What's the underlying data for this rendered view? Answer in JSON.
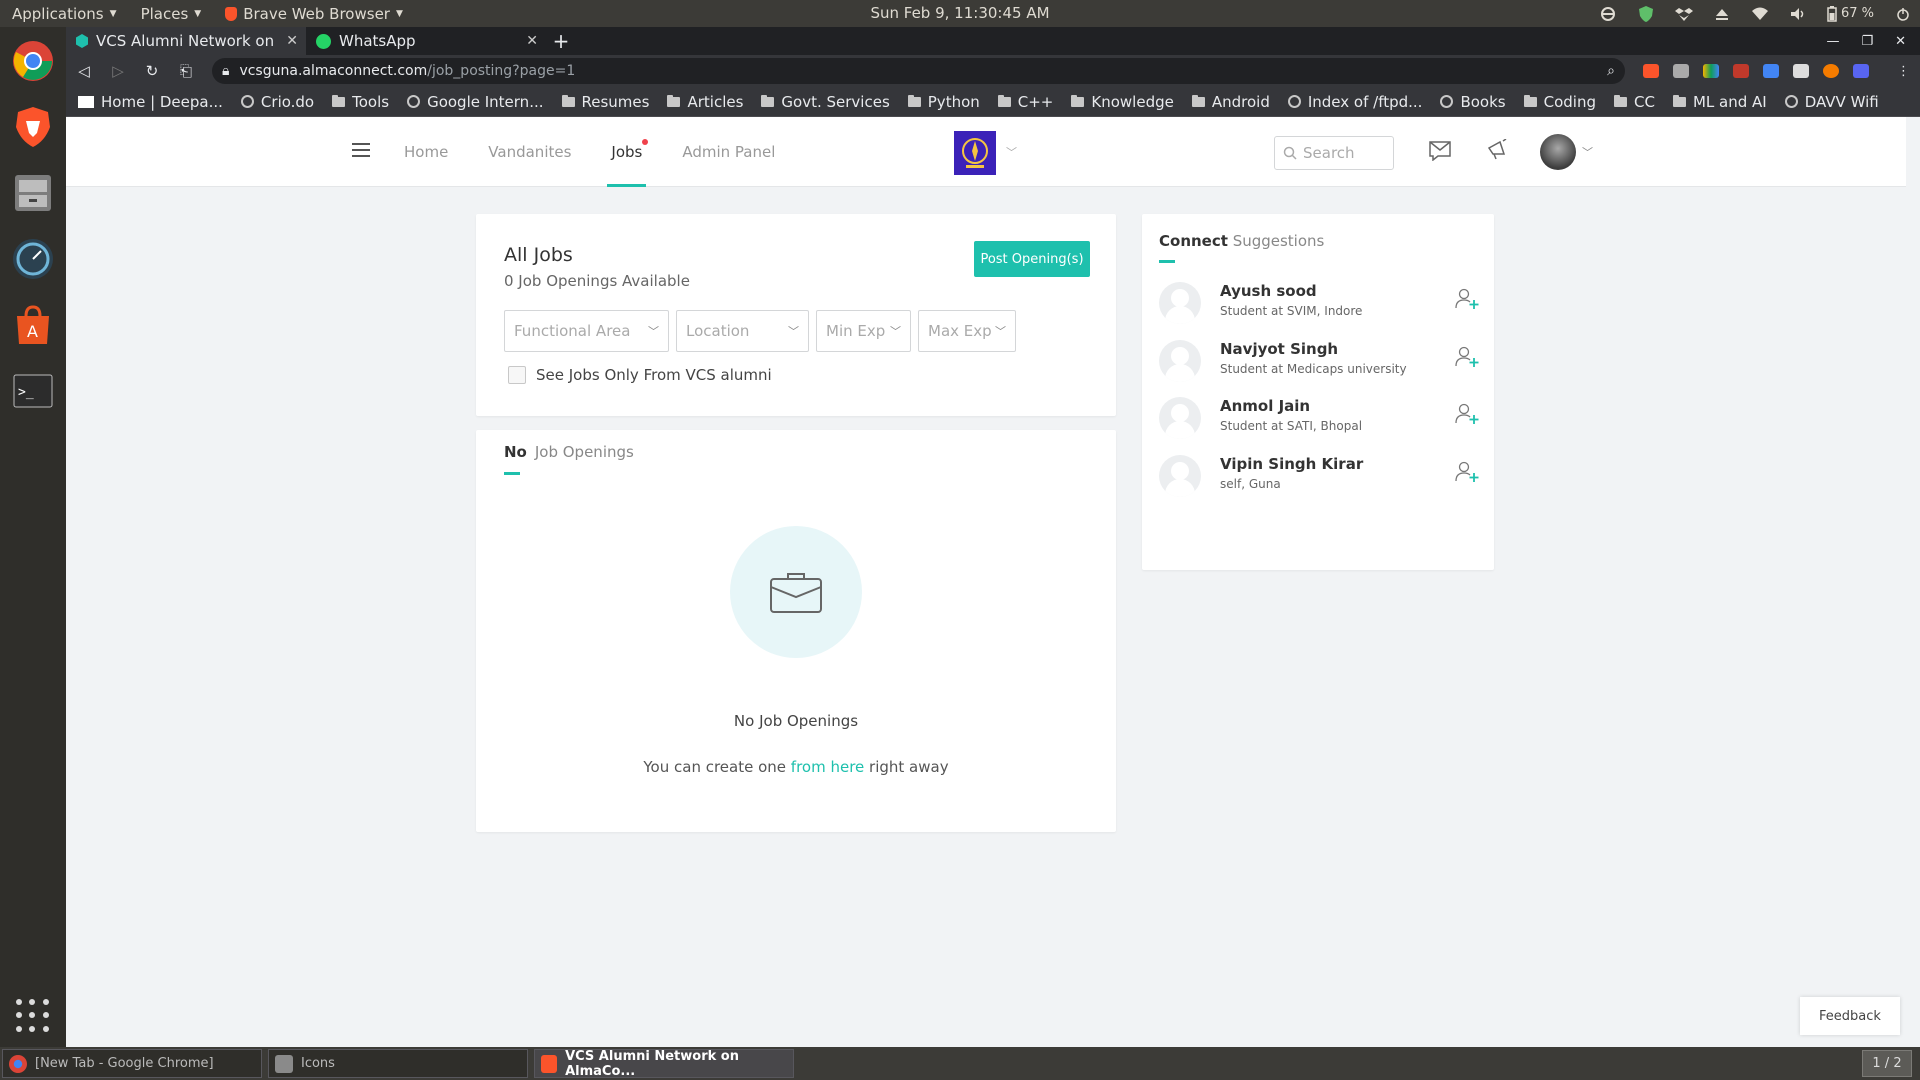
{
  "system": {
    "menus": [
      "Applications",
      "Places",
      "Brave Web Browser"
    ],
    "clock": "Sun Feb  9, 11:30:45 AM",
    "battery": "67 %"
  },
  "browser": {
    "tabs": [
      {
        "title": "VCS Alumni Network on Al",
        "active": true
      },
      {
        "title": "WhatsApp",
        "active": false
      }
    ],
    "url_host": "vcsguna.almaconnect.com",
    "url_path": "/job_posting?page=1",
    "bookmarks": [
      {
        "label": "Home | Deepa...",
        "icon": "wix-icon"
      },
      {
        "label": "Crio.do",
        "icon": "globe-icon"
      },
      {
        "label": "Tools",
        "icon": "folder-icon"
      },
      {
        "label": "Google Intern...",
        "icon": "globe-icon"
      },
      {
        "label": "Resumes",
        "icon": "folder-icon"
      },
      {
        "label": "Articles",
        "icon": "folder-icon"
      },
      {
        "label": "Govt. Services",
        "icon": "folder-icon"
      },
      {
        "label": "Python",
        "icon": "folder-icon"
      },
      {
        "label": "C++",
        "icon": "folder-icon"
      },
      {
        "label": "Knowledge",
        "icon": "folder-icon"
      },
      {
        "label": "Android",
        "icon": "folder-icon"
      },
      {
        "label": "Index of /ftpd...",
        "icon": "globe-icon"
      },
      {
        "label": "Books",
        "icon": "globe-icon"
      },
      {
        "label": "Coding",
        "icon": "folder-icon"
      },
      {
        "label": "CC",
        "icon": "folder-icon"
      },
      {
        "label": "ML and AI",
        "icon": "folder-icon"
      },
      {
        "label": "DAVV Wifi",
        "icon": "globe-icon"
      }
    ]
  },
  "site": {
    "nav": [
      "Home",
      "Vandanites",
      "Jobs",
      "Admin Panel"
    ],
    "search_placeholder": "Search"
  },
  "all_jobs": {
    "title": "All Jobs",
    "subtitle": "0 Job Openings Available",
    "post_button": "Post Opening(s)",
    "filters": [
      "Functional Area",
      "Location",
      "Min Exp",
      "Max Exp"
    ],
    "checkbox_label": "See Jobs Only From VCS alumni"
  },
  "openings": {
    "tab_bold": "No",
    "tab_rest": "Job Openings",
    "empty_title": "No Job Openings",
    "empty_pre": "You can create one ",
    "empty_link": "from here",
    "empty_post": " right away"
  },
  "suggestions": {
    "title_bold": "Connect",
    "title_rest": "Suggestions",
    "people": [
      {
        "name": "Ayush sood",
        "desc": "Student at SVIM, Indore"
      },
      {
        "name": "Navjyot Singh",
        "desc": "Student at Medicaps university"
      },
      {
        "name": "Anmol Jain",
        "desc": "Student at SATI, Bhopal"
      },
      {
        "name": "Vipin Singh Kirar",
        "desc": "self, Guna"
      }
    ]
  },
  "feedback": "Feedback",
  "taskbar": {
    "tasks": [
      "[New Tab - Google Chrome]",
      "Icons",
      "VCS Alumni Network on AlmaCo..."
    ],
    "pager": "1 / 2"
  },
  "colors": {
    "accent": "#1ec0ad",
    "notif": "#f0424c"
  }
}
